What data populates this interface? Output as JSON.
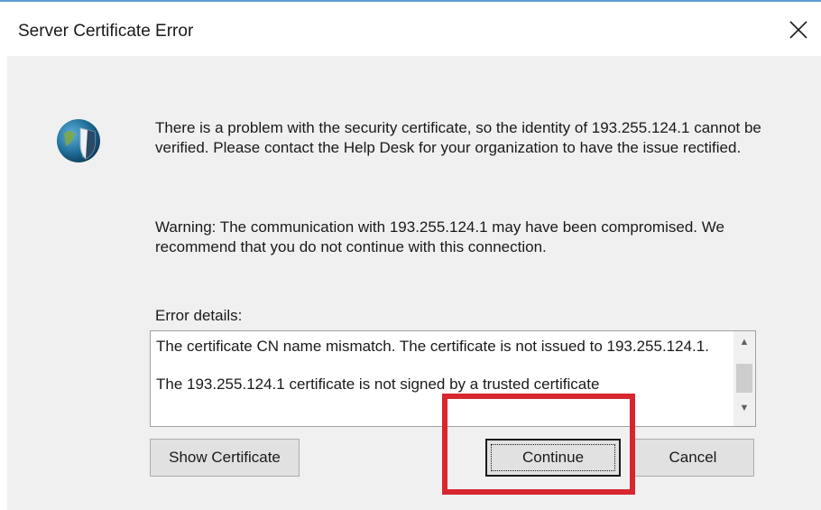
{
  "dialog": {
    "title": "Server Certificate Error",
    "close_icon": "close-icon",
    "security_icon": "shield-globe-icon",
    "message": "There is a problem with the security certificate, so the identity of 193.255.124.1 cannot be verified. Please contact the Help Desk for your organization to have the issue rectified.",
    "warning": "Warning: The communication with 193.255.124.1 may have been compromised. We recommend that you do not continue with this connection.",
    "error_details_label": "Error details:",
    "error_details": [
      "The certificate CN name mismatch. The certificate is not issued to 193.255.124.1.",
      "The 193.255.124.1 certificate is not signed by a trusted certificate"
    ]
  },
  "buttons": {
    "show_certificate": "Show Certificate",
    "continue": "Continue",
    "cancel": "Cancel"
  },
  "annotation": {
    "highlight_color": "#d8262f"
  },
  "colors": {
    "dialog_bg": "#f0f0f0",
    "title_accent": "#5b9bd5"
  }
}
